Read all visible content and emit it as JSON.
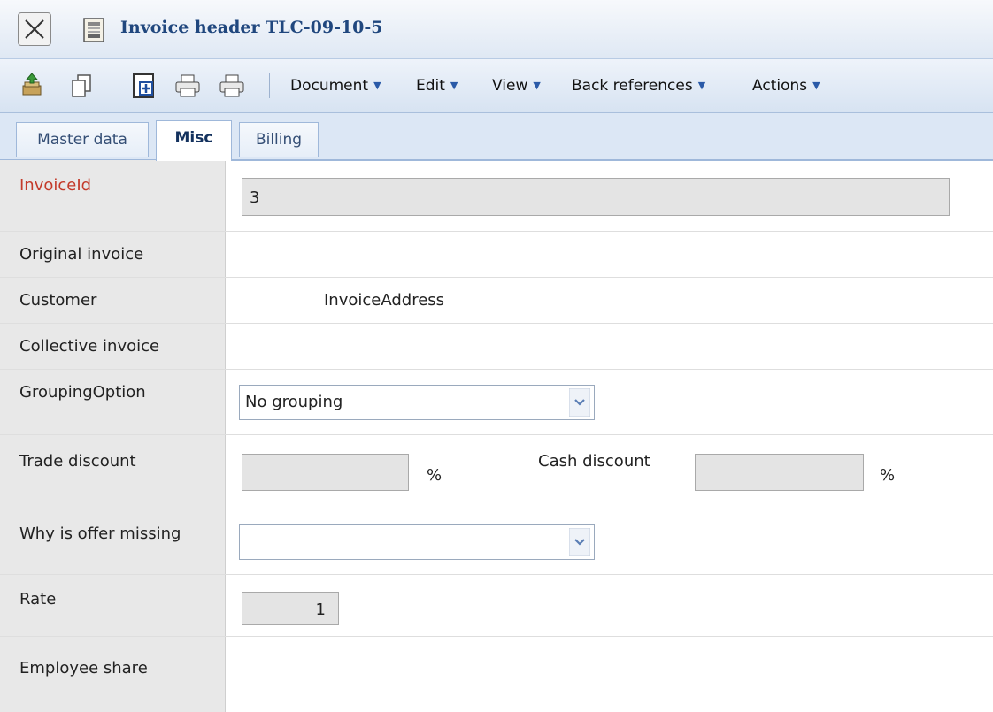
{
  "window": {
    "title": "Invoice header TLC-09-10-5"
  },
  "toolbar": {
    "menus": [
      "Document",
      "Edit",
      "View",
      "Back references",
      "Actions"
    ]
  },
  "tabs": [
    {
      "label": "Master data",
      "active": false
    },
    {
      "label": "Misc",
      "active": true
    },
    {
      "label": "Billing",
      "active": false
    }
  ],
  "form": {
    "invoice_id": {
      "label": "InvoiceId",
      "value": "3"
    },
    "original_invoice": {
      "label": "Original invoice"
    },
    "customer": {
      "label": "Customer",
      "value": "InvoiceAddress"
    },
    "collective_invoice": {
      "label": "Collective invoice"
    },
    "grouping_option": {
      "label": "GroupingOption",
      "value": "No grouping"
    },
    "trade_discount": {
      "label": "Trade discount",
      "value": "",
      "unit": "%"
    },
    "cash_discount": {
      "label": "Cash discount",
      "value": "",
      "unit": "%"
    },
    "why_offer_missing": {
      "label": "Why is offer missing",
      "value": ""
    },
    "rate": {
      "label": "Rate",
      "value": "1"
    },
    "employee_share": {
      "label": "Employee share"
    }
  },
  "colors": {
    "required_label": "#c33a2a",
    "title_text": "#20477e",
    "label_column_bg": "#e8e8e8",
    "readonly_field_bg": "#e4e4e4"
  }
}
